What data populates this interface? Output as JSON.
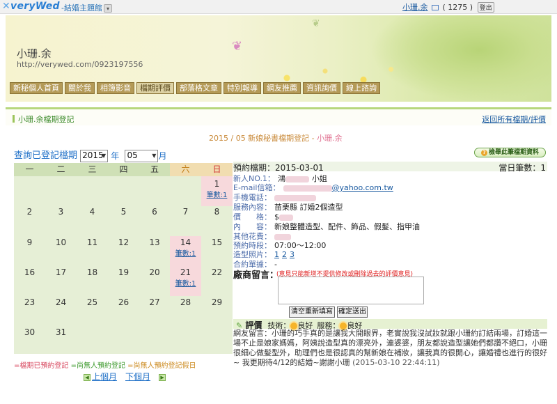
{
  "topbar": {
    "logo_x": "✕",
    "logo_text": "veryWed",
    "theme_hall": "-結婚主題館",
    "user_name": "小珊.余",
    "count": "( 1275 )",
    "logout": "登出"
  },
  "banner": {
    "name": "小珊.余",
    "url": "http://verywed.com/0923197556",
    "nav": [
      "新秘個人首頁",
      "關於我",
      "相簿影音",
      "檔期評價",
      "部落格文章",
      "特別報導",
      "網友推薦",
      "資訊詢價",
      "線上諮詢"
    ]
  },
  "section": {
    "title": "小珊.余檔期登記",
    "back_link": "返回所有檔期/評價"
  },
  "main_title": {
    "prefix": "2015 / 05 新娘秘書檔期登記 - ",
    "name": "小珊.余"
  },
  "query": {
    "label": "查詢已登記檔期",
    "year": "2015",
    "year_unit": "年",
    "month": "05",
    "month_unit": "月"
  },
  "detail_button": "檢舉此筆檔期資料",
  "calendar": {
    "weekdays": [
      "一",
      "二",
      "三",
      "四",
      "五",
      "六",
      "日"
    ],
    "days": {
      "d1": "1",
      "d2": "2",
      "d3": "3",
      "d4": "4",
      "d5": "5",
      "d6": "6",
      "d7": "7",
      "d8": "8",
      "d9": "9",
      "d10": "10",
      "d11": "11",
      "d12": "12",
      "d13": "13",
      "d14": "14",
      "d15": "15",
      "d16": "16",
      "d17": "17",
      "d18": "18",
      "d19": "19",
      "d20": "20",
      "d21": "21",
      "d22": "22",
      "d23": "23",
      "d24": "24",
      "d25": "25",
      "d26": "26",
      "d27": "27",
      "d28": "28",
      "d29": "29",
      "d30": "30",
      "d31": "31"
    },
    "count_label": "筆數:1"
  },
  "legend": {
    "booked": "=檔期已預約登記",
    "free": "=尚無人預約登記",
    "holiday": "=尚無人預約登記假日"
  },
  "pager": {
    "prev": "上個月",
    "next": "下個月"
  },
  "detail": {
    "date_label": "預約檔期：2015-03-01",
    "count_label": "當日筆數：1",
    "rows": {
      "newbie_label": "新人NO.1：",
      "newbie_v1": "鴻",
      "newbie_v2": "小姐",
      "email_label": "E-mail信箱：",
      "email_v": "@yahoo.com.tw",
      "phone_label": "手機電話：",
      "service_label": "服務內容：",
      "service_v": "苗栗縣 訂婚2個造型",
      "price_label": "價　　格：",
      "price_v": "$",
      "content_label": "內　　容：",
      "content_v": "新娘整體造型、配件、飾品、假髮、指甲油",
      "other_label": "其他花費：",
      "time_label": "預約時段：",
      "time_v": "07:00～12:00",
      "photos_label": "造型照片：",
      "photos": [
        "1",
        "2",
        "3"
      ],
      "contract_label": "合約單據：",
      "contract_v": "-"
    },
    "message_label": "廠商留言：",
    "message_warn": "(意見只能新增不提供修改或刪除過去的評價意見)",
    "clear_btn": "清空重新填寫",
    "submit_btn": "確定送出",
    "review_title": "評價",
    "tech_label": "技術：",
    "tech_value": "良好",
    "service_label": "服務：",
    "service_value": "良好",
    "review_text": "網友留言：小珊的巧手真的是讓我大開眼界，老實說我沒試妝就跟小珊約訂結兩場，訂婚這一場不止是娘家媽媽，阿姨說造型真的漂亮外，連婆婆，朋友都說造型讓她們都讚不絕口，小珊很細心做髮型外，助理們也是很認真的幫新娘在補妝，讓我真的很開心，讓婚禮也進行的很好~ 我更期待4/12的結婚~謝謝小珊",
    "review_time": "(2015-03-10 22:44:11)"
  },
  "colors": {
    "booked": "#f7d9dc",
    "calendar_bg": "#e6efd6",
    "nav_bg": "#b49a57",
    "link": "#1a5aa0"
  }
}
